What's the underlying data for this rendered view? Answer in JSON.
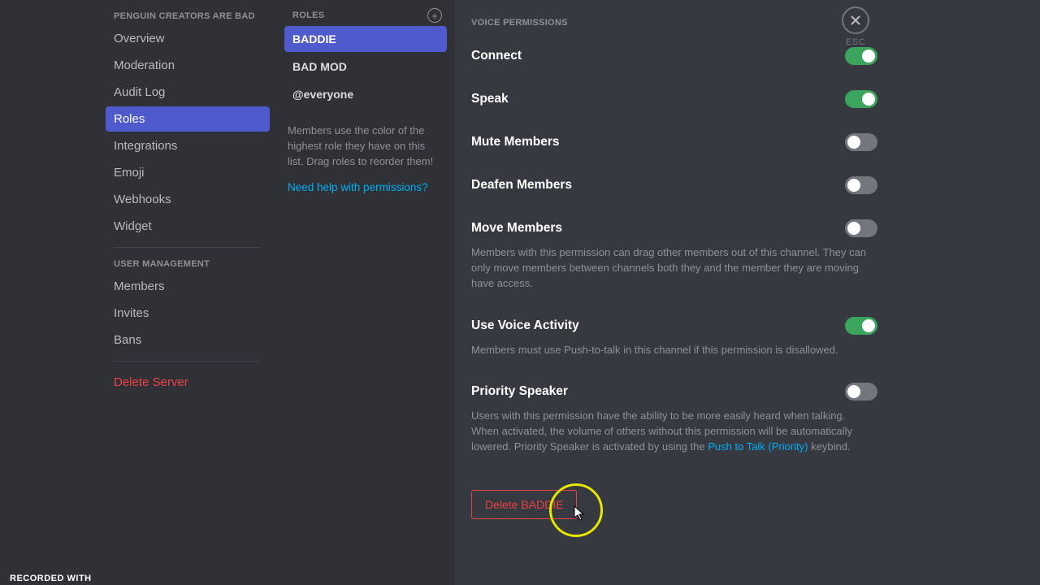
{
  "sidebar": {
    "serverHeading": "PENGUIN CREATORS ARE BAD",
    "items": [
      {
        "label": "Overview",
        "selected": false
      },
      {
        "label": "Moderation",
        "selected": false
      },
      {
        "label": "Audit Log",
        "selected": false
      },
      {
        "label": "Roles",
        "selected": true
      },
      {
        "label": "Integrations",
        "selected": false
      },
      {
        "label": "Emoji",
        "selected": false
      },
      {
        "label": "Webhooks",
        "selected": false
      },
      {
        "label": "Widget",
        "selected": false
      }
    ],
    "userMgmtHeading": "USER MANAGEMENT",
    "userMgmtItems": [
      {
        "label": "Members"
      },
      {
        "label": "Invites"
      },
      {
        "label": "Bans"
      }
    ],
    "deleteServer": "Delete Server"
  },
  "roles": {
    "heading": "ROLES",
    "items": [
      {
        "label": "BADDIE",
        "selected": true
      },
      {
        "label": "BAD MOD",
        "selected": false
      },
      {
        "label": "@everyone",
        "selected": false
      }
    ],
    "helpText": "Members use the color of the highest role they have on this list. Drag roles to reorder them!",
    "helpLink": "Need help with permissions?"
  },
  "permissions": {
    "sectionHeading": "VOICE PERMISSIONS",
    "items": [
      {
        "title": "Connect",
        "desc": "",
        "on": true
      },
      {
        "title": "Speak",
        "desc": "",
        "on": true
      },
      {
        "title": "Mute Members",
        "desc": "",
        "on": false
      },
      {
        "title": "Deafen Members",
        "desc": "",
        "on": false
      },
      {
        "title": "Move Members",
        "desc": "Members with this permission can drag other members out of this channel. They can only move members between channels both they and the member they are moving have access.",
        "on": false
      },
      {
        "title": "Use Voice Activity",
        "desc": "Members must use Push-to-talk in this channel if this permission is disallowed.",
        "on": true
      },
      {
        "title": "Priority Speaker",
        "descPre": "Users with this permission have the ability to be more easily heard when talking. When activated, the volume of others without this permission will be automatically lowered. Priority Speaker is activated by using the ",
        "link": "Push to Talk (Priority)",
        "descPost": " keybind.",
        "on": false
      }
    ],
    "deleteRole": "Delete BADDIE"
  },
  "close": {
    "label": "ESC"
  },
  "recordedWith": "RECORDED WITH"
}
